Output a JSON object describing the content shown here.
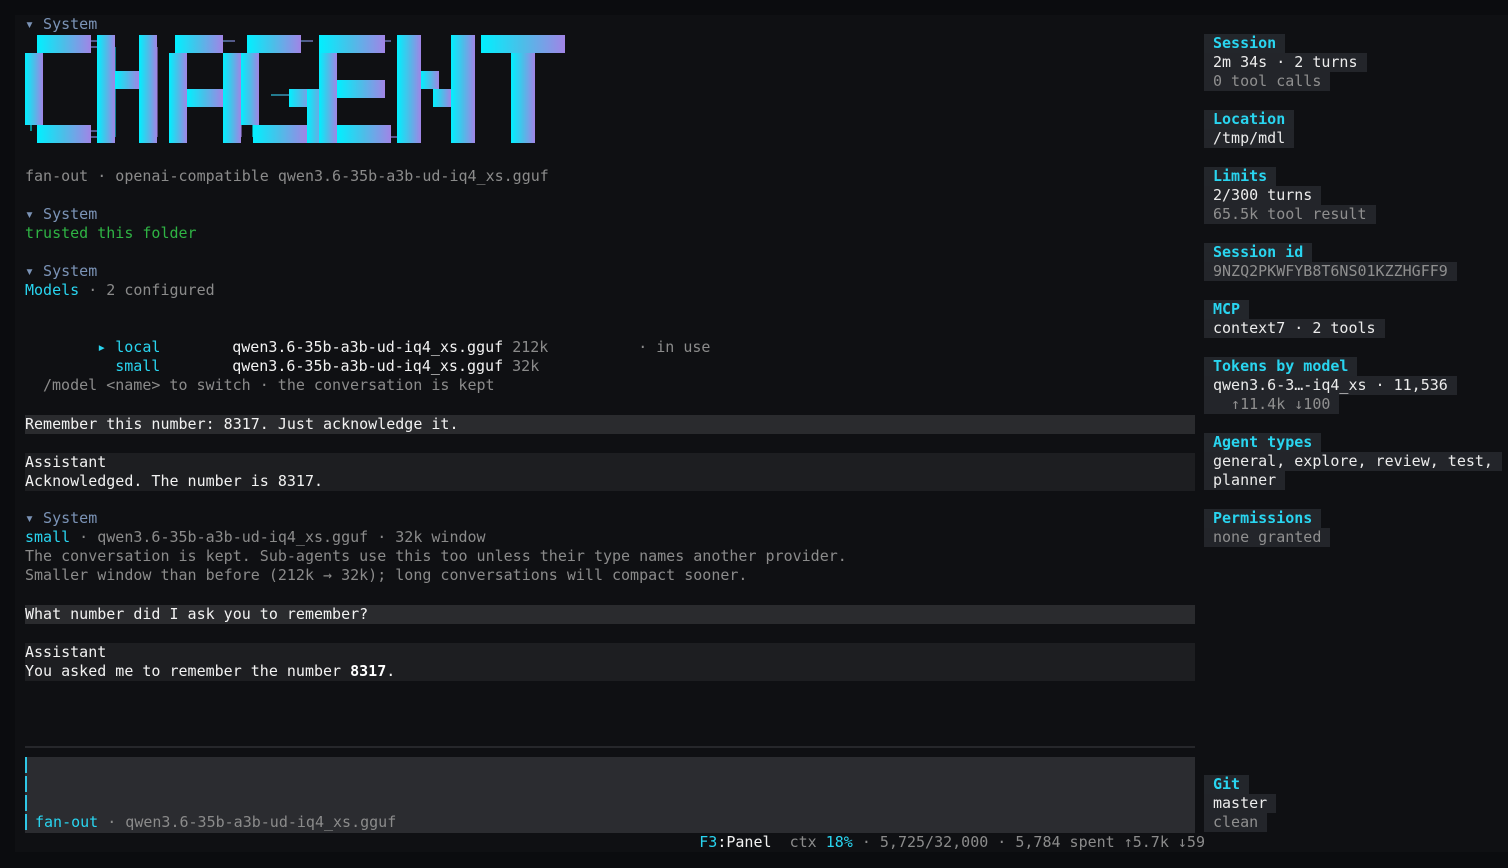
{
  "conversation": {
    "system_label": "▾ System",
    "header_line": "fan-out · openai-compatible qwen3.6-35b-a3b-ud-iq4_xs.gguf",
    "trusted": "trusted this folder",
    "models_title": "Models",
    "models_suffix": " · 2 configured",
    "models": [
      {
        "marker": "▸",
        "name": "local",
        "file": "qwen3.6-35b-a3b-ud-iq4_xs.gguf",
        "ctx": "212k",
        "status": "· in use"
      },
      {
        "marker": "",
        "name": "small",
        "file": "qwen3.6-35b-a3b-ud-iq4_xs.gguf",
        "ctx": "32k",
        "status": ""
      }
    ],
    "model_hint": "/model <name> to switch · the conversation is kept",
    "user_msg_1": "Remember this number: 8317. Just acknowledge it.",
    "assistant_label": "Assistant",
    "assistant_msg_1": "Acknowledged. The number is 8317.",
    "switch_model": "small",
    "switch_info": " · qwen3.6-35b-a3b-ud-iq4_xs.gguf · 32k window",
    "switch_note_1": "The conversation is kept. Sub-agents use this too unless their type names another provider.",
    "switch_note_2": "Smaller window than before (212k → 32k); long conversations will compact sooner.",
    "user_msg_2": "What number did I ask you to remember?",
    "assistant_msg_2_prefix": "You asked me to remember the number ",
    "assistant_msg_2_bold": "8317",
    "assistant_msg_2_suffix": "."
  },
  "logo": {
    "text": "CRAGENT",
    "gradient": [
      "#00f0ff",
      "#4dbde8",
      "#a184e6"
    ]
  },
  "input": {
    "mode": "fan-out",
    "model": " · qwen3.6-35b-a3b-ud-iq4_xs.gguf"
  },
  "status": {
    "panel_key": "F3",
    "panel_label": ":Panel",
    "ctx_label": "ctx ",
    "ctx_pct": "18%",
    "rest": " · 5,725/32,000 · 5,784 spent ↑5.7k ↓59"
  },
  "sidebar": {
    "session": {
      "title": "Session",
      "line1": "2m 34s · 2 turns",
      "line2": "0 tool calls"
    },
    "location": {
      "title": "Location",
      "line1": "/tmp/mdl"
    },
    "limits": {
      "title": "Limits",
      "line1": "2/300 turns",
      "line2": "65.5k tool result"
    },
    "session_id": {
      "title": "Session id",
      "line1": "9NZQ2PKWFYB8T6NS01KZZHGFF9"
    },
    "mcp": {
      "title": "MCP",
      "line1": "context7 · 2 tools"
    },
    "tokens": {
      "title": "Tokens by model",
      "line1": "qwen3.6-3…-iq4_xs · 11,536",
      "line2": "  ↑11.4k ↓100"
    },
    "agent_types": {
      "title": "Agent types",
      "line1": "general, explore, review, test,",
      "line2": "planner"
    },
    "permissions": {
      "title": "Permissions",
      "line1": "none granted"
    },
    "git": {
      "title": "Git",
      "line1": "master",
      "line2": "clean"
    }
  }
}
